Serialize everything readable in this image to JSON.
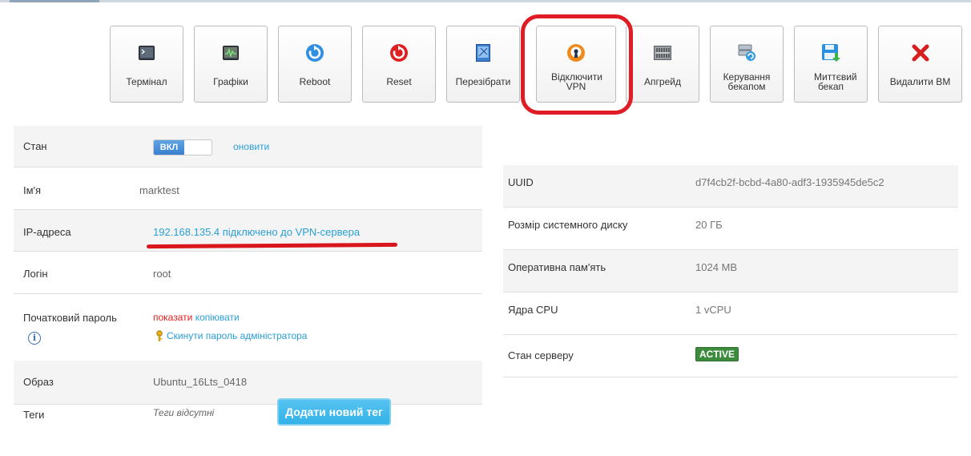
{
  "toolbar": {
    "buttons": [
      {
        "label": "Термінал",
        "icon": "terminal-icon"
      },
      {
        "label": "Графіки",
        "icon": "chart-icon"
      },
      {
        "label": "Reboot",
        "icon": "reboot-icon"
      },
      {
        "label": "Reset",
        "icon": "reset-icon"
      },
      {
        "label": "Перезібрати",
        "icon": "rebuild-icon"
      },
      {
        "label": "Відключити VPN",
        "icon": "vpn-icon"
      },
      {
        "label": "Апгрейд",
        "icon": "upgrade-icon"
      },
      {
        "label": "Керування бекапом",
        "icon": "backup-manage-icon"
      },
      {
        "label": "Миттєвий бекап",
        "icon": "instant-backup-icon"
      },
      {
        "label": "Видалити ВМ",
        "icon": "delete-icon"
      }
    ]
  },
  "left": {
    "state": {
      "key": "Стан",
      "toggle_on": "ВКЛ",
      "refresh": "оновити"
    },
    "name": {
      "key": "Ім'я",
      "value": "marktest"
    },
    "ip": {
      "key": "IP-адреса",
      "value": "192.168.135.4 підключено до VPN-сервера"
    },
    "login": {
      "key": "Логін",
      "value": "root"
    },
    "password": {
      "key": "Початковий пароль",
      "show": "показати",
      "copy": "копіювати",
      "reset": "Скинути пароль адміністратора"
    },
    "image": {
      "key": "Образ",
      "value": "Ubuntu_16Lts_0418"
    },
    "tags": {
      "key": "Теги",
      "value": "Теги відсутні",
      "add_button": "Додати новий тег"
    }
  },
  "right": {
    "uuid": {
      "key": "UUID",
      "value": "d7f4cb2f-bcbd-4a80-adf3-1935945de5c2"
    },
    "disk": {
      "key": "Розмір системного диску",
      "value": "20 ГБ"
    },
    "ram": {
      "key": "Оперативна пам'ять",
      "value": "1024 MB"
    },
    "cpu": {
      "key": "Ядра CPU",
      "value": "1 vCPU"
    },
    "status": {
      "key": "Стан серверу",
      "value": "ACTIVE"
    }
  },
  "colors": {
    "accent": "#2a9fd6",
    "danger": "#e01d25",
    "active": "#3d8b3d"
  }
}
